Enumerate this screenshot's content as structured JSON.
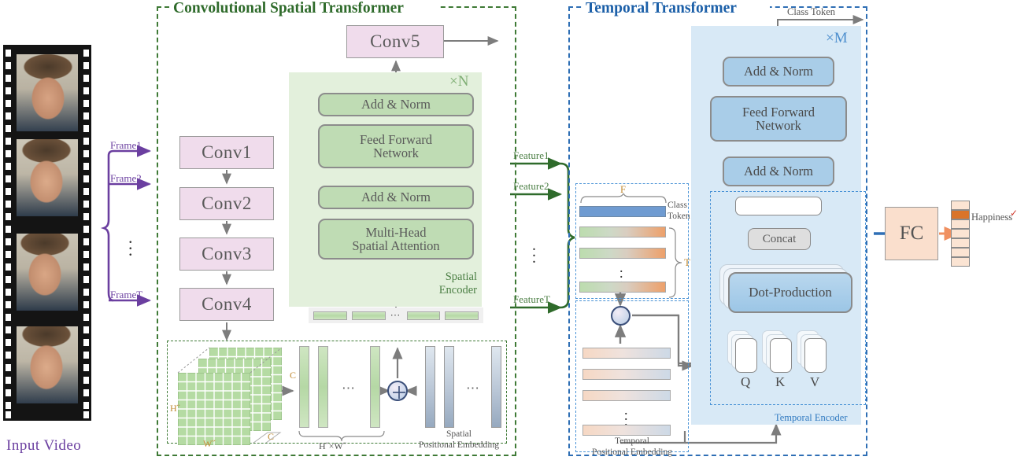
{
  "figure": {
    "type": "architecture-diagram",
    "description": "Convolutional Spatial Transformer and Temporal Transformer for video facial expression recognition"
  },
  "input": {
    "label": "Input Video",
    "frame_labels": [
      "Frame1",
      "Frame2",
      "FrameT"
    ],
    "vertical_dots": "⋮"
  },
  "spatial": {
    "title": "Convolutional Spatial Transformer",
    "repeat": "×N",
    "encoder_label_line1": "Spatial",
    "encoder_label_line2": "Encoder",
    "conv_blocks": [
      "Conv1",
      "Conv2",
      "Conv3",
      "Conv4"
    ],
    "conv5": "Conv5",
    "encoder_blocks": {
      "add_norm_top": "Add & Norm",
      "ffn": "Feed Forward\nNetwork",
      "ffn_line1": "Feed Forward",
      "ffn_line2": "Network",
      "add_norm_bottom": "Add & Norm",
      "attention_line1": "Multi-Head",
      "attention_line2": "Spatial Attention"
    },
    "feature_map": {
      "dim_h": "H˝",
      "dim_w": "W˝",
      "dim_c": "C",
      "channel_label": "C",
      "flatten_label": "H˝×W˝"
    },
    "positional_embedding_line1": "Spatial",
    "positional_embedding_line2": "Positional Embedding",
    "ellipsis": "⋯"
  },
  "features": {
    "labels": [
      "Feature1",
      "Feature2",
      "FeatureT"
    ],
    "vertical_dots": "⋮"
  },
  "temporal": {
    "title": "Temporal Transformer",
    "repeat": "×M",
    "class_token_top": "Class Token",
    "encoder_label": "Temporal Encoder",
    "blocks": {
      "add_norm_top": "Add & Norm",
      "ffn_line1": "Feed Forward",
      "ffn_line2": "Network",
      "add_norm_bottom": "Add & Norm",
      "concat": "Concat",
      "dot_production": "Dot-Production",
      "qkv": [
        "Q",
        "K",
        "V"
      ]
    },
    "token_stack": {
      "f_label": "F",
      "t_label": "T",
      "class_token_line1": "Class",
      "class_token_line2": "Token",
      "vertical_dots": "⋮"
    },
    "positional_embedding_line1": "Temporal",
    "positional_embedding_line2": "Positional Embedding",
    "pe_vertical_dots": "⋮"
  },
  "output": {
    "fc_label": "FC",
    "predicted_class": "Happiness",
    "check_mark": "✓",
    "num_classes": 7,
    "highlighted_index": 1
  },
  "colors": {
    "spatial_green": "#3f7a36",
    "spatial_title": "#2f6b2b",
    "temporal_blue": "#2f6fb5",
    "temporal_title": "#1b5fa8",
    "conv_fill": "#f0dcec",
    "green_block_fill": "#bfdcb4",
    "blue_block_fill": "#a9cde8",
    "fc_fill": "#fadfcd",
    "frame_arrow_purple": "#6b3fa0",
    "feature_arrow_green": "#2f6b2b",
    "output_arrow_orange": "#f09060",
    "highlight_orange": "#d9742a"
  }
}
